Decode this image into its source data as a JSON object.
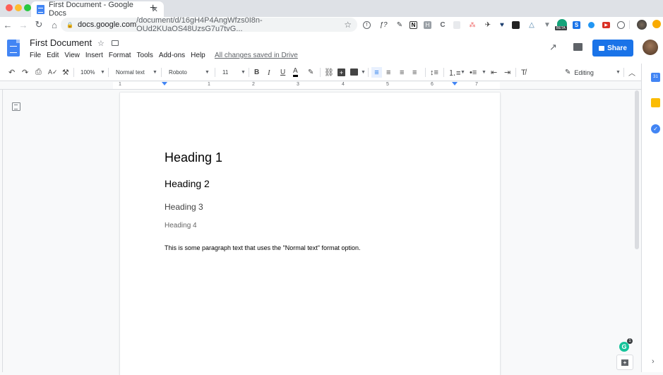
{
  "browser": {
    "tab_title": "First Document - Google Docs",
    "tab_close": "✕",
    "new_tab": "+",
    "url_domain": "docs.google.com",
    "url_path": "/document/d/16gH4P4AngWfzs0I8n-OUd2KUaOS48UzsG7u7tvG...",
    "nav": {
      "back": "←",
      "forward": "→",
      "reload": "↻",
      "home": "⌂"
    },
    "bookmark_star": "☆",
    "extensions": [
      "info-icon",
      "formula-icon",
      "eyedropper-icon",
      "notion-icon",
      "h-icon",
      "c-icon",
      "grey-ext-icon",
      "asana-icon",
      "bird-icon",
      "heart-icon",
      "screen-icon",
      "triangle-icon",
      "vee-icon",
      "beta-ext-icon",
      "s-icon",
      "messenger-icon",
      "youtube-icon",
      "circle-ext-icon"
    ],
    "beta_label": "BETA"
  },
  "doc": {
    "title": "First Document",
    "menu": [
      "File",
      "Edit",
      "View",
      "Insert",
      "Format",
      "Tools",
      "Add-ons",
      "Help"
    ],
    "save_status": "All changes saved in Drive",
    "share_label": "Share"
  },
  "toolbar": {
    "zoom": "100%",
    "style": "Normal text",
    "font": "Roboto",
    "font_size": "11",
    "mode": "Editing",
    "bold": "B",
    "italic": "I",
    "underline": "U",
    "text_color": "A"
  },
  "ruler": {
    "labels": [
      "1",
      "1",
      "2",
      "3",
      "4",
      "5",
      "6",
      "7"
    ]
  },
  "content": {
    "heading1": "Heading 1",
    "heading2": "Heading 2",
    "heading3": "Heading 3",
    "heading4": "Heading 4",
    "paragraph": "This is some paragraph text that uses the \"Normal text\" format option."
  },
  "grammarly": {
    "letter": "G",
    "count": "1"
  },
  "colors": {
    "accent": "#1a73e8",
    "docs_blue": "#4285f4"
  }
}
